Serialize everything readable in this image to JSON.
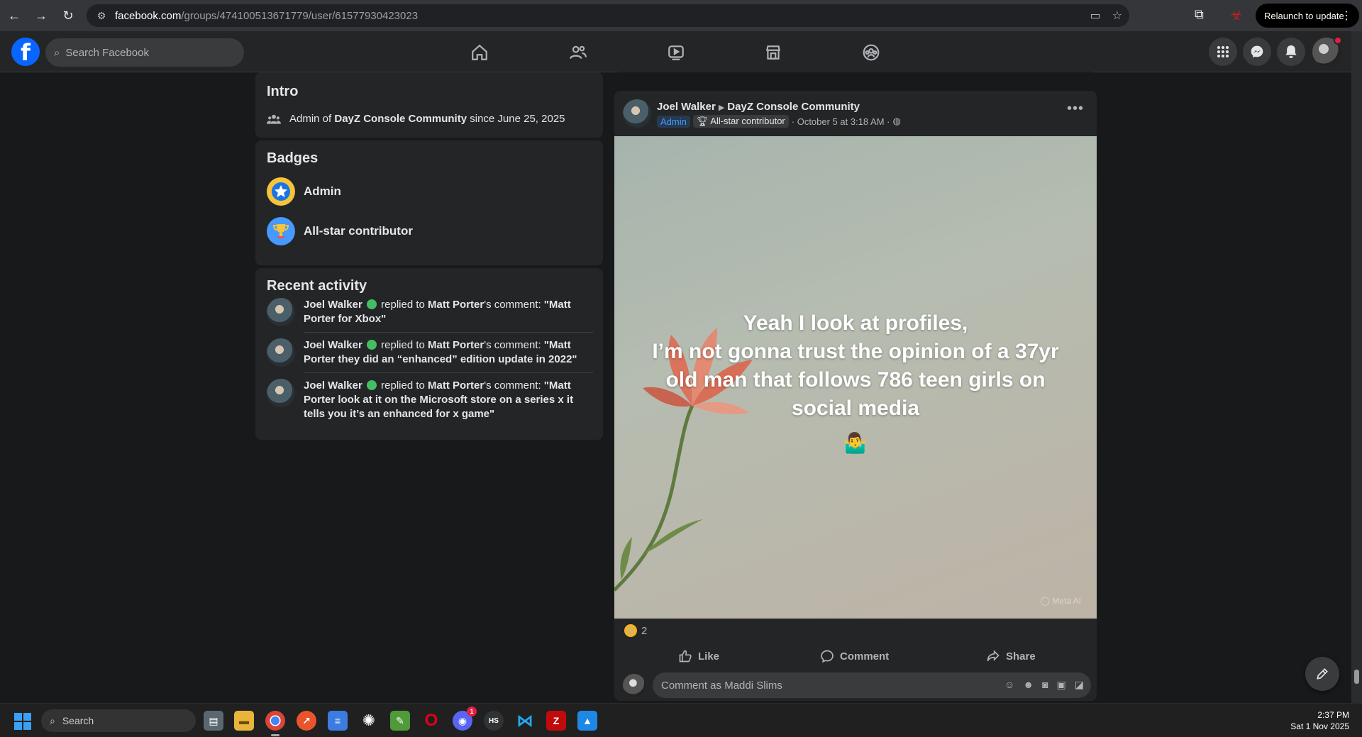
{
  "browser": {
    "url_host": "facebook.com",
    "url_path": "/groups/474100513671779/user/61577930423023",
    "relaunch_label": "Relaunch to update"
  },
  "header": {
    "search_placeholder": "Search Facebook"
  },
  "intro": {
    "title": "Intro",
    "prefix": "Admin of ",
    "group": "DayZ Console Community",
    "suffix": " since June 25, 2025"
  },
  "badges": {
    "title": "Badges",
    "items": [
      {
        "label": "Admin",
        "icon": "star-badge-icon",
        "color": "#1b74e4"
      },
      {
        "label": "All-star contributor",
        "icon": "trophy-badge-icon",
        "color": "#4599ff"
      }
    ]
  },
  "recent": {
    "title": "Recent activity",
    "items": [
      {
        "actor": "Joel Walker",
        "verb": " replied to ",
        "target": "Matt Porter",
        "tail": "'s comment: ",
        "quote": "\"Matt Porter for Xbox\""
      },
      {
        "actor": "Joel Walker",
        "verb": " replied to ",
        "target": "Matt Porter",
        "tail": "'s comment: ",
        "quote": "\"Matt Porter they did an “enhanced” edition update in 2022\""
      },
      {
        "actor": "Joel Walker",
        "verb": " replied to ",
        "target": "Matt Porter",
        "tail": "'s comment: ",
        "quote": "\"Matt Porter look at it on the Microsoft store on a series x it tells you it’s an enhanced for x game\""
      }
    ]
  },
  "post": {
    "author": "Joel Walker",
    "group": "DayZ Console Community",
    "tag_admin": "Admin",
    "tag_contributor": "All-star contributor",
    "time": "· October 5 at 3:18 AM ·",
    "caption_lines": [
      "Yeah I look at profiles,",
      "I’m not gonna trust the opinion of a 37yr",
      "old man that follows 786 teen girls on",
      "social media"
    ],
    "caption_emoji": "🤷‍♂️",
    "watermark": "◯ Meta AI",
    "reaction_count": "2",
    "like_label": "Like",
    "comment_label": "Comment",
    "share_label": "Share",
    "comment_placeholder": "Comment as Maddi Slims"
  },
  "taskbar": {
    "search_label": "Search",
    "time": "2:37 PM",
    "date": "Sat 1 Nov 2025",
    "discord_badge": "1"
  }
}
